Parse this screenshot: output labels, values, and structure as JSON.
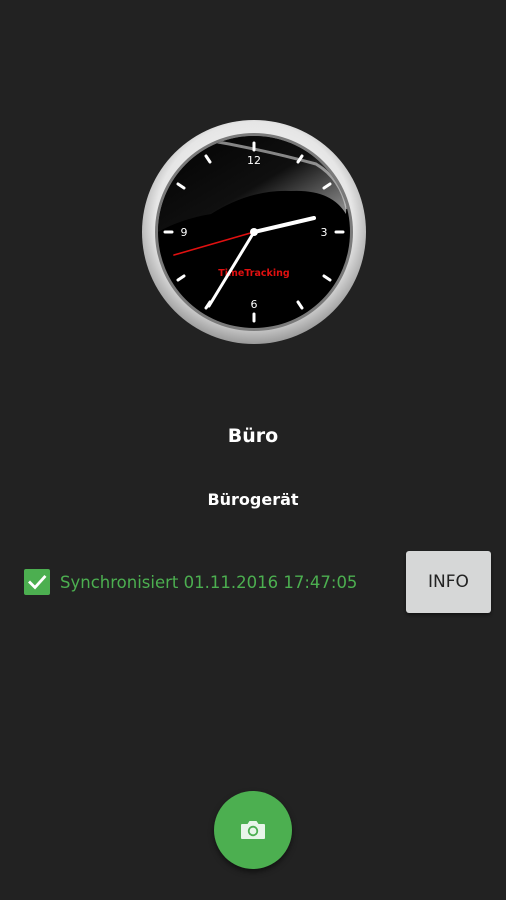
{
  "clock": {
    "numerals": {
      "twelve": "12",
      "three": "3",
      "six": "6",
      "nine": "9"
    },
    "brand": "TimeTracking",
    "icon": "analog-clock-icon"
  },
  "location": {
    "title": "Büro"
  },
  "device": {
    "name": "Bürogerät"
  },
  "sync": {
    "checked": true,
    "text": "Synchronisiert 01.11.2016 17:47:05",
    "icon": "checkmark-icon"
  },
  "info_button": {
    "label": "INFO"
  },
  "fab": {
    "icon": "camera-icon"
  },
  "colors": {
    "background": "#222222",
    "accent_green": "#4caf50",
    "button_grey": "#d6d7d7",
    "clock_red": "#e01010"
  }
}
